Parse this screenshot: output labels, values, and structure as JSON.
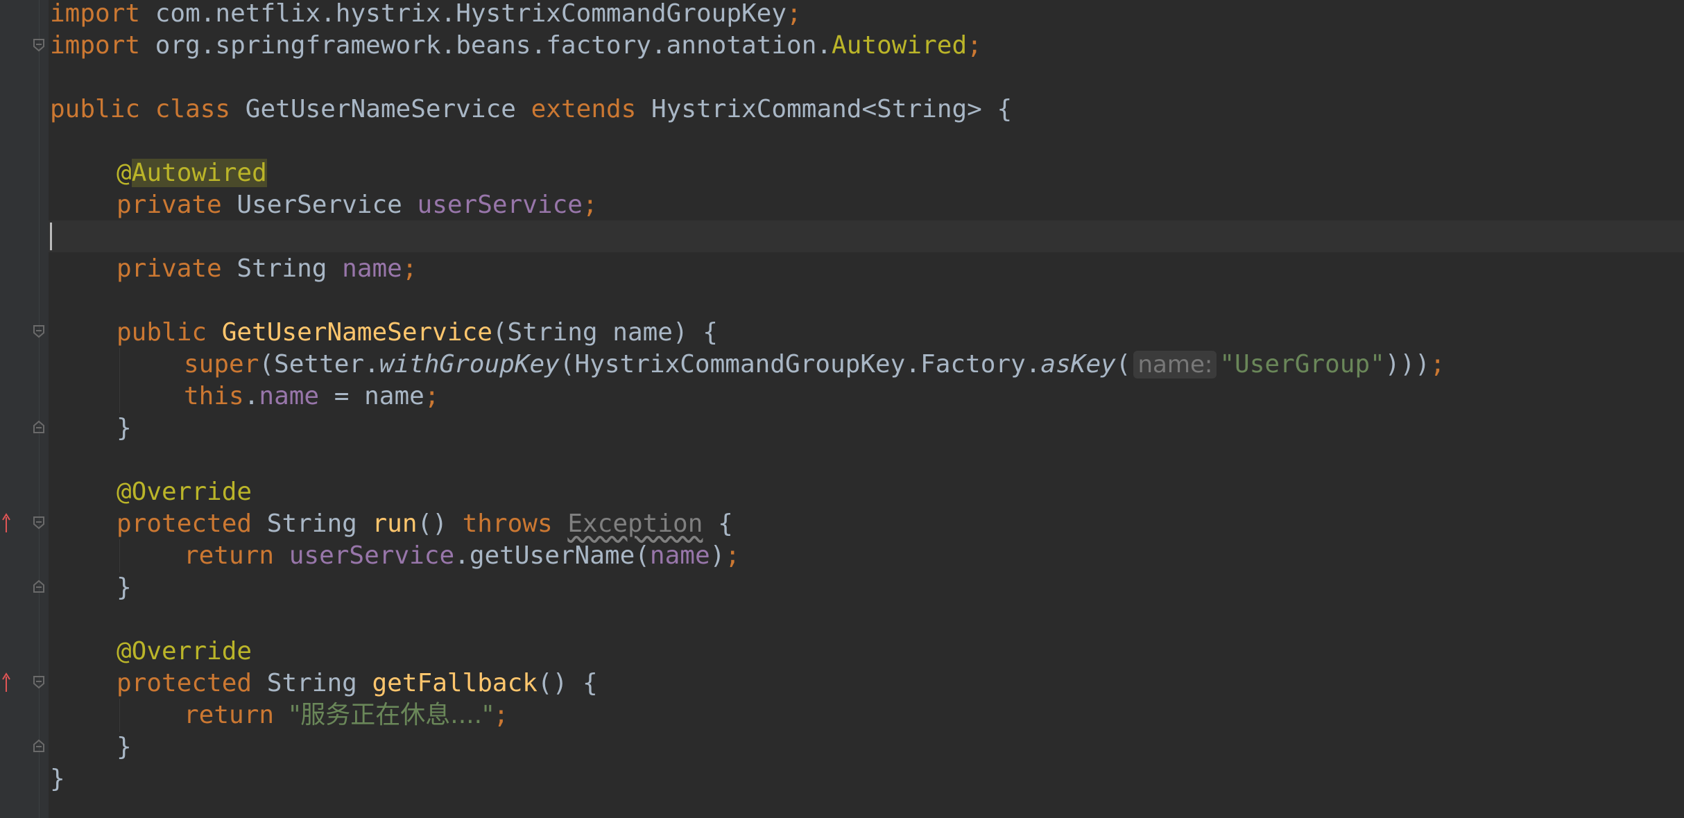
{
  "code": {
    "l1": {
      "kw": "import",
      "rest": " com.netflix.hystrix.HystrixCommandGroupKey",
      "semi": ";"
    },
    "l2": {
      "kw": "import",
      "rest": " org.springframework.beans.factory.annotation.",
      "cls": "Autowired",
      "semi": ";"
    },
    "l4": {
      "kw1": "public",
      "kw2": "class",
      "name": "GetUserNameService",
      "kw3": "extends",
      "rest": "HystrixCommand<String> {"
    },
    "l6": {
      "at": "@",
      "ann": "Autowired"
    },
    "l7": {
      "kw": "private",
      "type": "UserService",
      "field": "userService",
      "semi": ";"
    },
    "l9": {
      "kw": "private",
      "type": "String",
      "field": "name",
      "semi": ";"
    },
    "l11": {
      "kw": "public",
      "name": "GetUserNameService",
      "rest": "(String name) {"
    },
    "l12": {
      "kw": "super",
      "p1": "(Setter.",
      "m1": "withGroupKey",
      "p2": "(HystrixCommandGroupKey.Factory.",
      "m2": "asKey",
      "p3": "(",
      "hint": "name:",
      "str": "\"UserGroup\"",
      "p4": ")))",
      "semi": ";"
    },
    "l13": {
      "kw": "this",
      "dot": ".",
      "field": "name",
      "rest": " = name",
      "semi": ";"
    },
    "l14": {
      "brace": "}"
    },
    "l16": {
      "ann": "@Override"
    },
    "l17": {
      "kw1": "protected",
      "type": "String",
      "name": "run",
      "p": "()",
      "kw2": "throws",
      "exc": "Exception",
      "brace": "{"
    },
    "l18": {
      "kw": "return",
      "field": "userService",
      "call": ".getUserName(",
      "arg": "name",
      "close": ")",
      "semi": ";"
    },
    "l19": {
      "brace": "}"
    },
    "l21": {
      "ann": "@Override"
    },
    "l22": {
      "kw": "protected",
      "type": "String",
      "name": "getFallback",
      "rest": "() {"
    },
    "l23": {
      "kw": "return",
      "str": "\"服务正在休息....\"",
      "semi": ";"
    },
    "l24": {
      "brace": "}"
    },
    "l25": {
      "brace": "}"
    }
  },
  "colors": {
    "background": "#2b2b2b",
    "keyword": "#cc7832",
    "identifier": "#a9b7c6",
    "annotation": "#bbb529",
    "field": "#9876aa",
    "method": "#ffc66d",
    "string": "#6a8759"
  },
  "icons": {
    "fold": "fold-marker-icon",
    "override": "override-arrow-icon"
  }
}
